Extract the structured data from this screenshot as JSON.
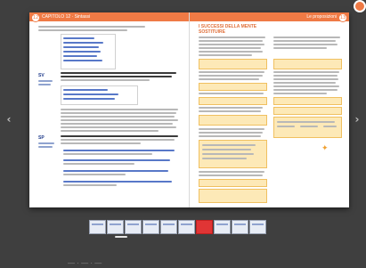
{
  "viewer": {
    "left_header": "CAPITOLO 12 · Sintassi",
    "right_header": "Le proposizioni",
    "left_page_number": "12",
    "right_page_number": "13",
    "section_sv_label": "SV",
    "section_sp_label": "SP",
    "right_title": "I SUCCESSI DELLA MENTE",
    "right_subtitle": "SOSTITUIRE",
    "nav_prev_symbol": "‹",
    "nav_next_symbol": "›",
    "bottom_caption": "— · — · —"
  },
  "thumbnails": [
    {
      "label": "1"
    },
    {
      "label": "2"
    },
    {
      "label": "3"
    },
    {
      "label": "4"
    },
    {
      "label": "5"
    },
    {
      "label": "6"
    },
    {
      "label": "7"
    },
    {
      "label": "8"
    },
    {
      "label": "9"
    },
    {
      "label": "10"
    }
  ],
  "colors": {
    "accent": "#ef7a45",
    "highlight": "#fde9b7",
    "viewer_bg": "#3f3f3f"
  }
}
